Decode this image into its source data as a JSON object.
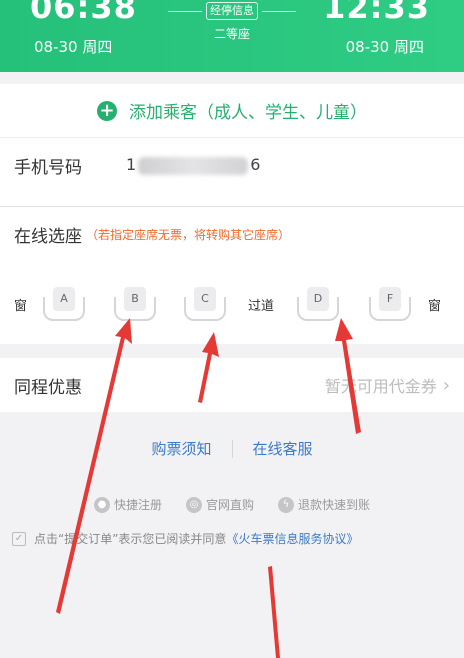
{
  "header": {
    "depart_time": "06:38",
    "arrive_time": "12:33",
    "depart_date": "08-30 周四",
    "arrive_date": "08-30 周四",
    "stop_info": "经停信息",
    "seat_class": "二等座"
  },
  "passenger": {
    "add_label": "添加乘客（成人、学生、儿童）",
    "phone_label": "手机号码",
    "phone_prefix": "1",
    "phone_suffix": "6"
  },
  "seat_selection": {
    "title": "在线选座",
    "note": "（若指定座席无票，将转购其它座席）",
    "window_left": "窗",
    "window_right": "窗",
    "aisle": "过道",
    "seats": [
      "A",
      "B",
      "C",
      "D",
      "F"
    ]
  },
  "discount": {
    "label": "同程优惠",
    "value": "暂无可用代金券"
  },
  "links": {
    "purchase_notice": "购票须知",
    "online_service": "在线客服"
  },
  "features": {
    "quick_register": "快捷注册",
    "official_buy": "官网直购",
    "fast_refund": "退款快速到账"
  },
  "agreement": {
    "text": "点击“提交订单”表示您已阅读并同意",
    "link": "《火车票信息服务协议》"
  },
  "colors": {
    "brand_green": "#26b06f",
    "note_orange": "#f06a2a",
    "link_blue": "#3b7ac9",
    "arrow_red": "#e53935"
  }
}
